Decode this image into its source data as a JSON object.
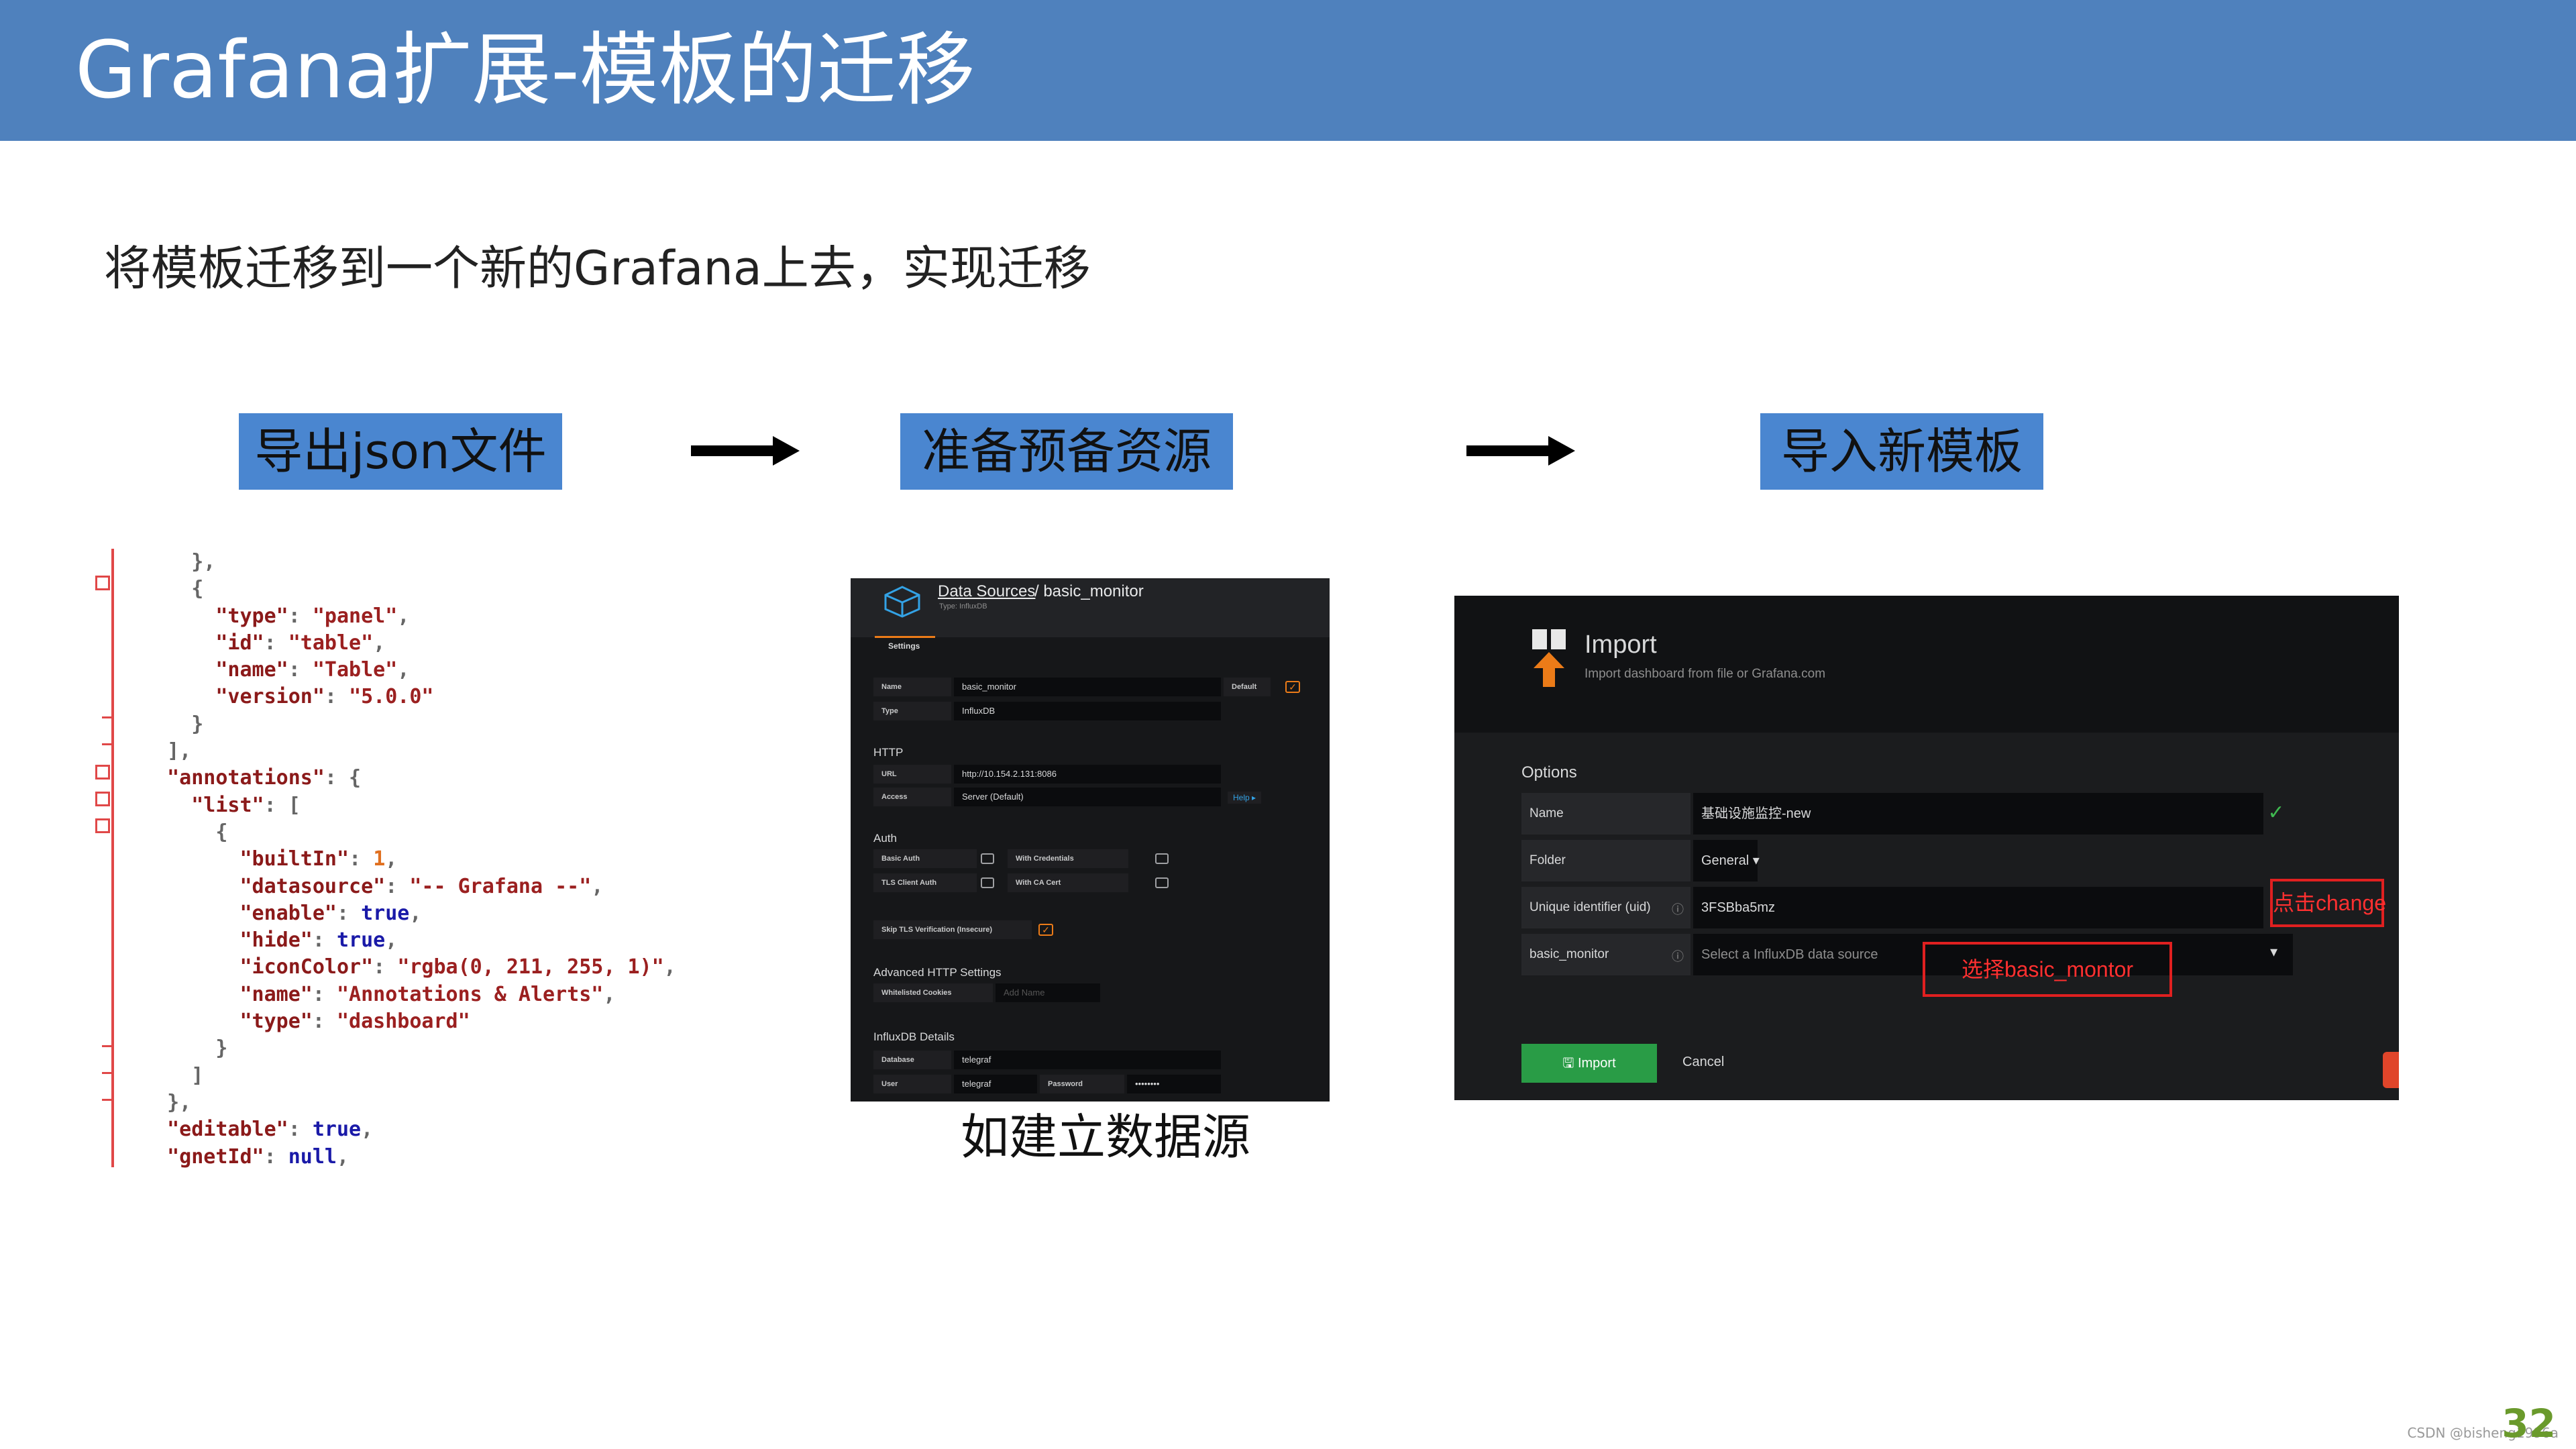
{
  "header": {
    "title": "Grafana扩展-模板的迁移"
  },
  "subtitle": "将模板迁移到一个新的Grafana上去，实现迁移",
  "steps": {
    "export": "导出json文件",
    "prepare": "准备预备资源",
    "import": "导入新模板"
  },
  "code": {
    "lines": [
      [
        [
          "p",
          "    },"
        ]
      ],
      [
        [
          "p",
          "    {"
        ]
      ],
      [
        [
          "p",
          "      "
        ],
        [
          "k",
          "\"type\""
        ],
        [
          "p",
          ": "
        ],
        [
          "s",
          "\"panel\""
        ],
        [
          "p",
          ","
        ]
      ],
      [
        [
          "p",
          "      "
        ],
        [
          "k",
          "\"id\""
        ],
        [
          "p",
          ": "
        ],
        [
          "s",
          "\"table\""
        ],
        [
          "p",
          ","
        ]
      ],
      [
        [
          "p",
          "      "
        ],
        [
          "k",
          "\"name\""
        ],
        [
          "p",
          ": "
        ],
        [
          "s",
          "\"Table\""
        ],
        [
          "p",
          ","
        ]
      ],
      [
        [
          "p",
          "      "
        ],
        [
          "k",
          "\"version\""
        ],
        [
          "p",
          ": "
        ],
        [
          "s",
          "\"5.0.0\""
        ]
      ],
      [
        [
          "p",
          "    }"
        ]
      ],
      [
        [
          "p",
          "  ],"
        ]
      ],
      [
        [
          "p",
          "  "
        ],
        [
          "k",
          "\"annotations\""
        ],
        [
          "p",
          ": {"
        ]
      ],
      [
        [
          "p",
          "    "
        ],
        [
          "k",
          "\"list\""
        ],
        [
          "p",
          ": ["
        ]
      ],
      [
        [
          "p",
          "      {"
        ]
      ],
      [
        [
          "p",
          "        "
        ],
        [
          "k",
          "\"builtIn\""
        ],
        [
          "p",
          ": "
        ],
        [
          "n",
          "1"
        ],
        [
          "p",
          ","
        ]
      ],
      [
        [
          "p",
          "        "
        ],
        [
          "k",
          "\"datasource\""
        ],
        [
          "p",
          ": "
        ],
        [
          "s",
          "\"-- Grafana --\""
        ],
        [
          "p",
          ","
        ]
      ],
      [
        [
          "p",
          "        "
        ],
        [
          "k",
          "\"enable\""
        ],
        [
          "p",
          ": "
        ],
        [
          "b",
          "true"
        ],
        [
          "p",
          ","
        ]
      ],
      [
        [
          "p",
          "        "
        ],
        [
          "k",
          "\"hide\""
        ],
        [
          "p",
          ": "
        ],
        [
          "b",
          "true"
        ],
        [
          "p",
          ","
        ]
      ],
      [
        [
          "p",
          "        "
        ],
        [
          "k",
          "\"iconColor\""
        ],
        [
          "p",
          ": "
        ],
        [
          "s",
          "\"rgba(0, 211, 255, 1)\""
        ],
        [
          "p",
          ","
        ]
      ],
      [
        [
          "p",
          "        "
        ],
        [
          "k",
          "\"name\""
        ],
        [
          "p",
          ": "
        ],
        [
          "s",
          "\"Annotations & Alerts\""
        ],
        [
          "p",
          ","
        ]
      ],
      [
        [
          "p",
          "        "
        ],
        [
          "k",
          "\"type\""
        ],
        [
          "p",
          ": "
        ],
        [
          "s",
          "\"dashboard\""
        ]
      ],
      [
        [
          "p",
          "      }"
        ]
      ],
      [
        [
          "p",
          "    ]"
        ]
      ],
      [
        [
          "p",
          "  },"
        ]
      ],
      [
        [
          "p",
          "  "
        ],
        [
          "k",
          "\"editable\""
        ],
        [
          "p",
          ": "
        ],
        [
          "b",
          "true"
        ],
        [
          "p",
          ","
        ]
      ],
      [
        [
          "p",
          "  "
        ],
        [
          "k",
          "\"gnetId\""
        ],
        [
          "p",
          ": "
        ],
        [
          "b",
          "null"
        ],
        [
          "p",
          ","
        ]
      ]
    ]
  },
  "datasource_screen": {
    "breadcrumb_link": "Data Sources",
    "breadcrumb_rest": " / basic_monitor",
    "type_label": "Type: InfluxDB",
    "settings_tab": "Settings",
    "name_label": "Name",
    "name_value": "basic_monitor",
    "default_label": "Default",
    "type_field_label": "Type",
    "type_value": "InfluxDB",
    "http_header": "HTTP",
    "url_label": "URL",
    "url_value": "http://10.154.2.131:8086",
    "access_label": "Access",
    "access_value": "Server (Default)",
    "help_label": "Help ▸",
    "auth_header": "Auth",
    "basic_auth": "Basic Auth",
    "with_credentials": "With Credentials",
    "tls_client_auth": "TLS Client Auth",
    "with_ca_cert": "With CA Cert",
    "skip_tls": "Skip TLS Verification (Insecure)",
    "advanced_header": "Advanced HTTP Settings",
    "whitelisted_cookies": "Whitelisted Cookies",
    "add_name_placeholder": "Add Name",
    "influx_header": "InfluxDB Details",
    "database_label": "Database",
    "database_value": "telegraf",
    "user_label": "User",
    "user_value": "telegraf",
    "password_label": "Password",
    "password_value": "••••••••"
  },
  "caption": "如建立数据源",
  "import_screen": {
    "title": "Import",
    "subtitle": "Import dashboard from file or Grafana.com",
    "options_label": "Options",
    "name_label": "Name",
    "name_value": "基础设施监控-new",
    "folder_label": "Folder",
    "folder_value": "General ▾",
    "uid_label": "Unique identifier (uid)",
    "uid_value": "3FSBba5mz",
    "ds_label": "basic_monitor",
    "ds_placeholder": "Select a InfluxDB data source",
    "import_button": "Import",
    "cancel_button": "Cancel",
    "annotation_change": "点击change",
    "annotation_select": "选择basic_montor"
  },
  "footer": {
    "watermark": "CSDN @bisheng1996a",
    "page_number": "32"
  },
  "colors": {
    "header": "#4f81bd",
    "step_box": "#4a86d0",
    "annotation_red": "#e02020",
    "grafana_orange": "#eb7b18",
    "import_green": "#299c46"
  }
}
